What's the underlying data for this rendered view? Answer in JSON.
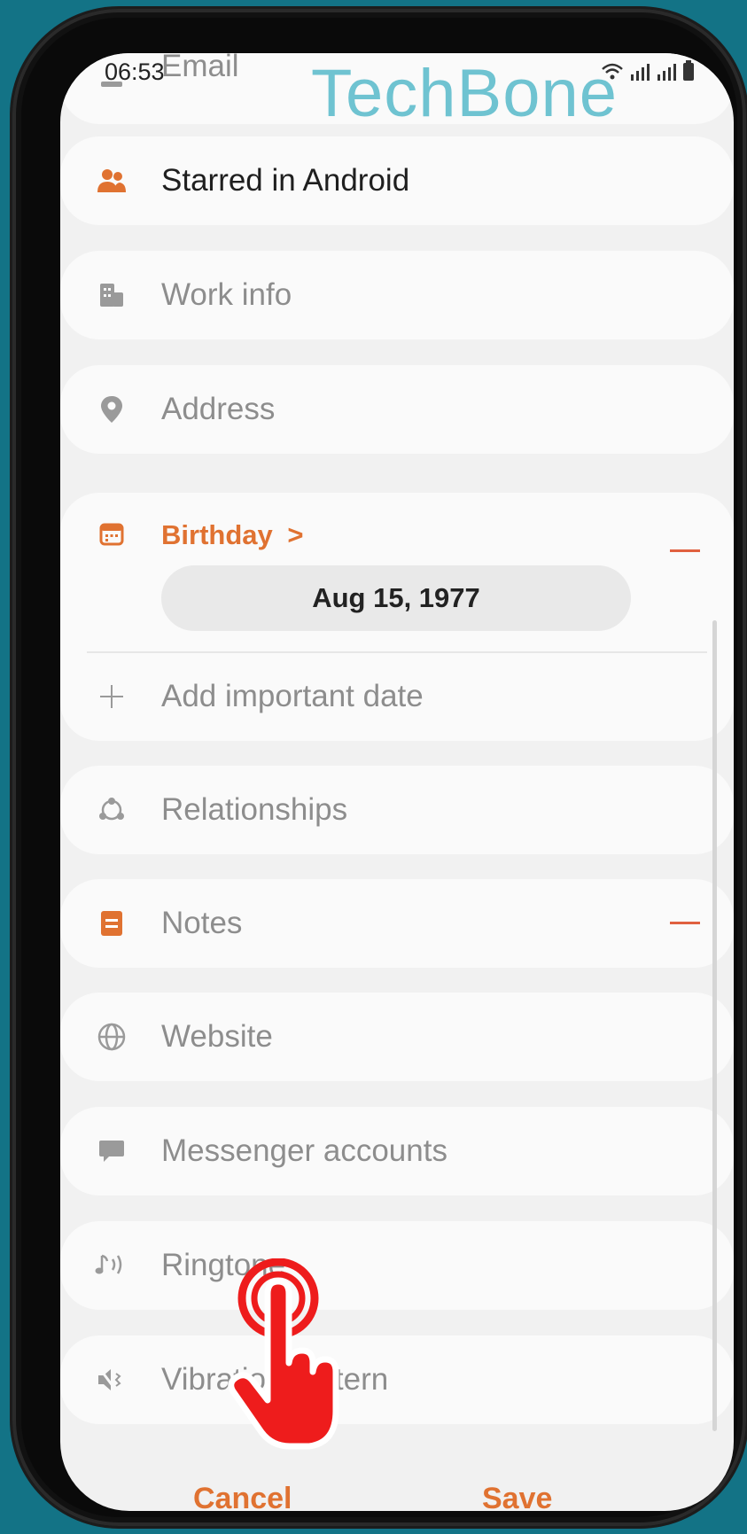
{
  "status": {
    "time": "06:53"
  },
  "watermark": "TechBone",
  "rows": {
    "email": "Email",
    "starred": "Starred in Android",
    "work_info": "Work info",
    "address": "Address",
    "birthday": "Birthday",
    "birthday_chevron": ">",
    "birthday_date": "Aug 15, 1977",
    "add_date": "Add important date",
    "relationships": "Relationships",
    "notes": "Notes",
    "website": "Website",
    "messenger": "Messenger accounts",
    "ringtone": "Ringtone",
    "vibration": "Vibration pattern"
  },
  "footer": {
    "cancel": "Cancel",
    "save": "Save"
  },
  "colors": {
    "accent": "#e07231",
    "remove": "#e0603f",
    "background": "#137386",
    "watermark": "#6fc3d1",
    "tap_hand": "#ee1c1c"
  },
  "icons": {
    "starred": "people-icon",
    "work_info": "building-icon",
    "address": "location-pin-icon",
    "birthday": "calendar-icon",
    "add_date": "plus-icon",
    "relationships": "relationship-icon",
    "notes": "note-icon",
    "website": "globe-icon",
    "messenger": "chat-bubble-icon",
    "ringtone": "ringtone-icon",
    "vibration": "vibration-icon",
    "tap": "tap-hand-icon"
  }
}
